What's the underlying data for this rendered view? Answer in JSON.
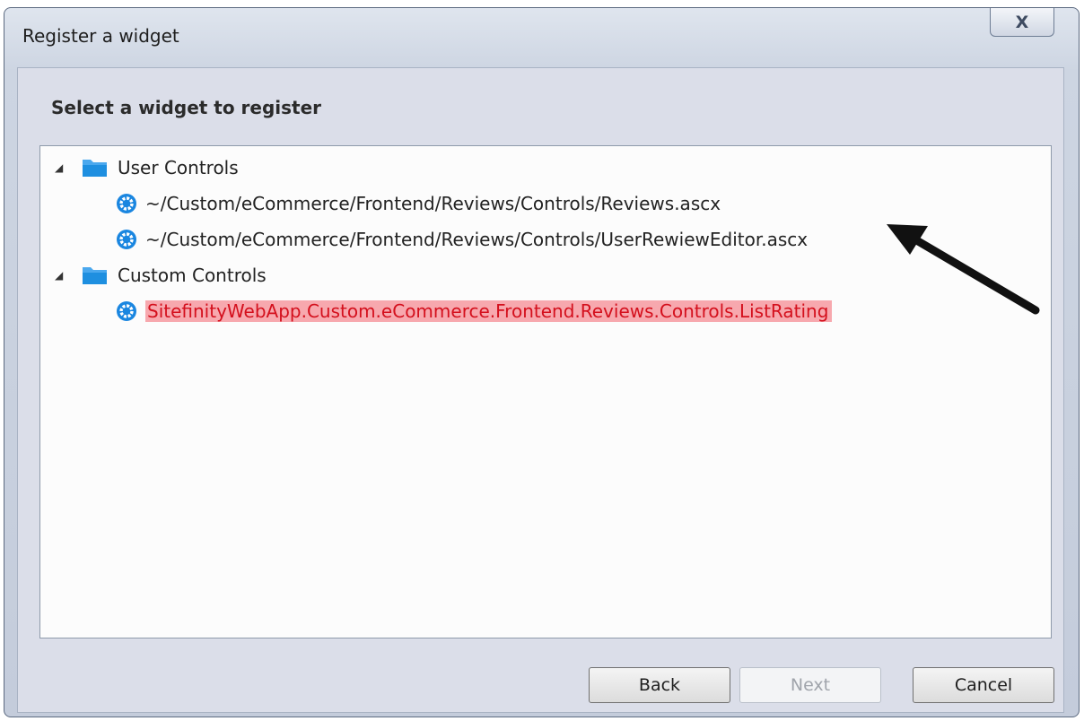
{
  "window": {
    "title": "Register a widget"
  },
  "content": {
    "heading": "Select a widget to register"
  },
  "tree": {
    "groups": [
      {
        "label": "User Controls",
        "items": [
          {
            "label": "~/Custom/eCommerce/Frontend/Reviews/Controls/Reviews.ascx",
            "selected": false
          },
          {
            "label": "~/Custom/eCommerce/Frontend/Reviews/Controls/UserRewiewEditor.ascx",
            "selected": false
          }
        ]
      },
      {
        "label": "Custom Controls",
        "items": [
          {
            "label": "SitefinityWebApp.Custom.eCommerce.Frontend.Reviews.Controls.ListRating",
            "selected": true
          }
        ]
      }
    ]
  },
  "buttons": {
    "back": "Back",
    "next": "Next",
    "cancel": "Cancel"
  },
  "colors": {
    "selection_highlight": "#f7a8ae",
    "selection_text": "#d4101d",
    "folder_blue": "#1e8fe0",
    "gear_blue": "#1a86e0"
  },
  "icons": [
    "close-icon",
    "expand-triangle-icon",
    "folder-icon",
    "gear-icon",
    "arrow-annotation-icon"
  ]
}
